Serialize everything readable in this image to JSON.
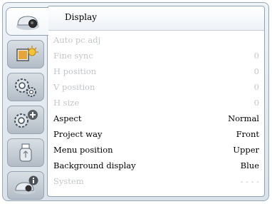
{
  "menu": {
    "title": "Display",
    "items": [
      {
        "label": "Auto pc adj",
        "value": "",
        "enabled": false
      },
      {
        "label": "Fine sync",
        "value": "0",
        "enabled": false
      },
      {
        "label": "H position",
        "value": "0",
        "enabled": false
      },
      {
        "label": "V position",
        "value": "0",
        "enabled": false
      },
      {
        "label": "H size",
        "value": "0",
        "enabled": false
      },
      {
        "label": "Aspect",
        "value": "Normal",
        "enabled": true
      },
      {
        "label": "Project way",
        "value": "Front",
        "enabled": true
      },
      {
        "label": "Menu position",
        "value": "Upper",
        "enabled": true
      },
      {
        "label": "Background display",
        "value": "Blue",
        "enabled": true
      },
      {
        "label": "System",
        "value": "- - - -",
        "enabled": false
      }
    ]
  },
  "sidebar": {
    "tabs": [
      {
        "icon": "display-icon",
        "active": true
      },
      {
        "icon": "image-adjust-icon",
        "active": false
      },
      {
        "icon": "setting-gear-icon",
        "active": false
      },
      {
        "icon": "expanded-setting-icon",
        "active": false
      },
      {
        "icon": "usb-memory-icon",
        "active": false
      },
      {
        "icon": "information-icon",
        "active": false
      }
    ]
  },
  "colors": {
    "accent": "#8fa2b6",
    "enabled_text": "#000000",
    "disabled_text": "#c3c6c9"
  }
}
